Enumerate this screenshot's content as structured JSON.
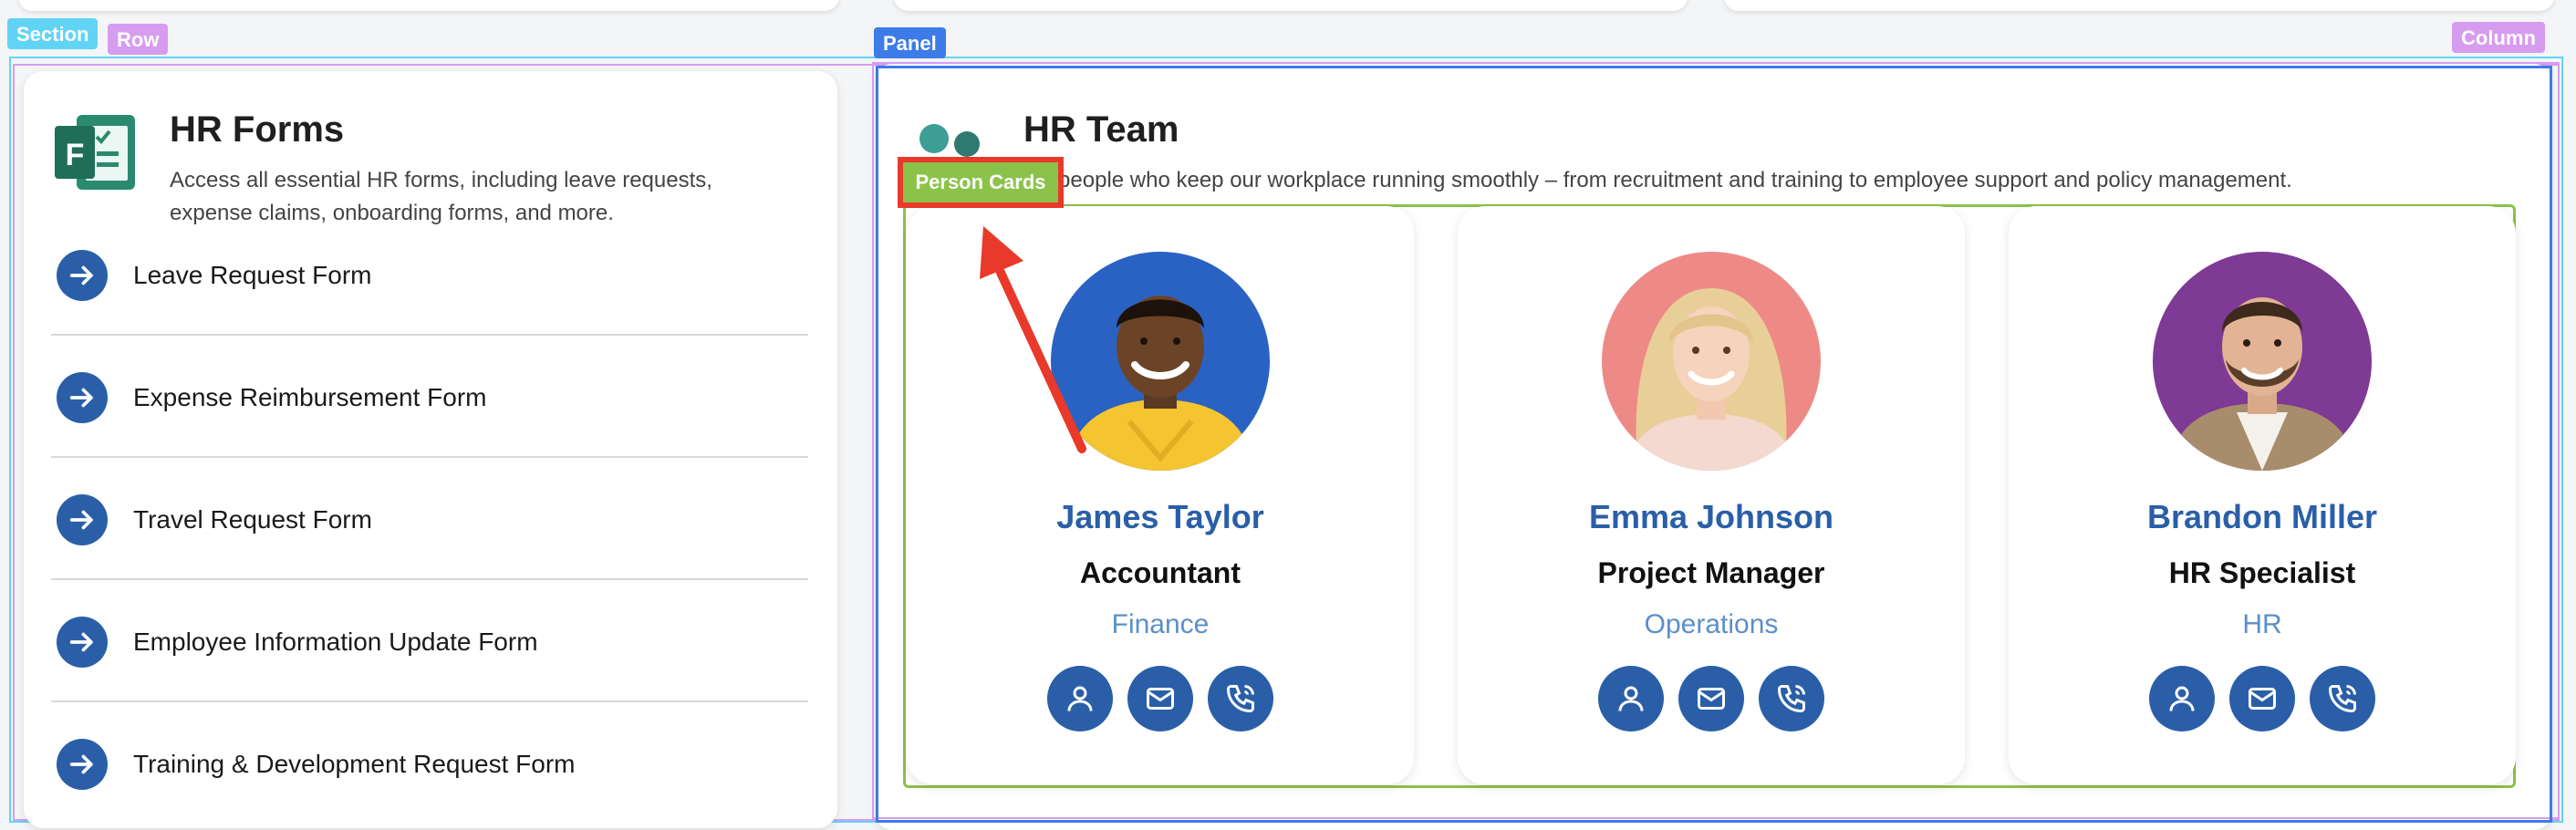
{
  "overlay_labels": {
    "section": "Section",
    "row": "Row",
    "panel": "Panel",
    "column": "Column",
    "person_cards": "Person Cards"
  },
  "hr_forms": {
    "title": "HR Forms",
    "description": "Access all essential HR forms, including leave requests, expense claims, onboarding forms, and more.",
    "items": [
      {
        "label": "Leave Request Form",
        "icon": "arrow-right-icon"
      },
      {
        "label": "Expense Reimbursement Form",
        "icon": "arrow-right-icon"
      },
      {
        "label": "Travel Request Form",
        "icon": "arrow-right-icon"
      },
      {
        "label": "Employee Information Update Form",
        "icon": "arrow-right-icon"
      },
      {
        "label": "Training & Development Request Form",
        "icon": "arrow-right-icon"
      }
    ]
  },
  "hr_team": {
    "title": "HR Team",
    "description": "Meet the people who keep our workplace running smoothly – from recruitment and training to employee support and policy management.",
    "people": [
      {
        "name": "James Taylor",
        "role": "Accountant",
        "department": "Finance",
        "avatar_bg": "#2a62c4"
      },
      {
        "name": "Emma Johnson",
        "role": "Project Manager",
        "department": "Operations",
        "avatar_bg": "#ee8a86"
      },
      {
        "name": "Brandon Miller",
        "role": "HR Specialist",
        "department": "HR",
        "avatar_bg": "#7e3a94"
      }
    ]
  },
  "colors": {
    "accent": "#2a5fa8",
    "section_outline": "#61d4f5",
    "row_outline": "#d69cf0",
    "panel_outline": "#3c7be8",
    "person_cards_outline": "#8bc34a",
    "annotation_red": "#e8392a"
  }
}
